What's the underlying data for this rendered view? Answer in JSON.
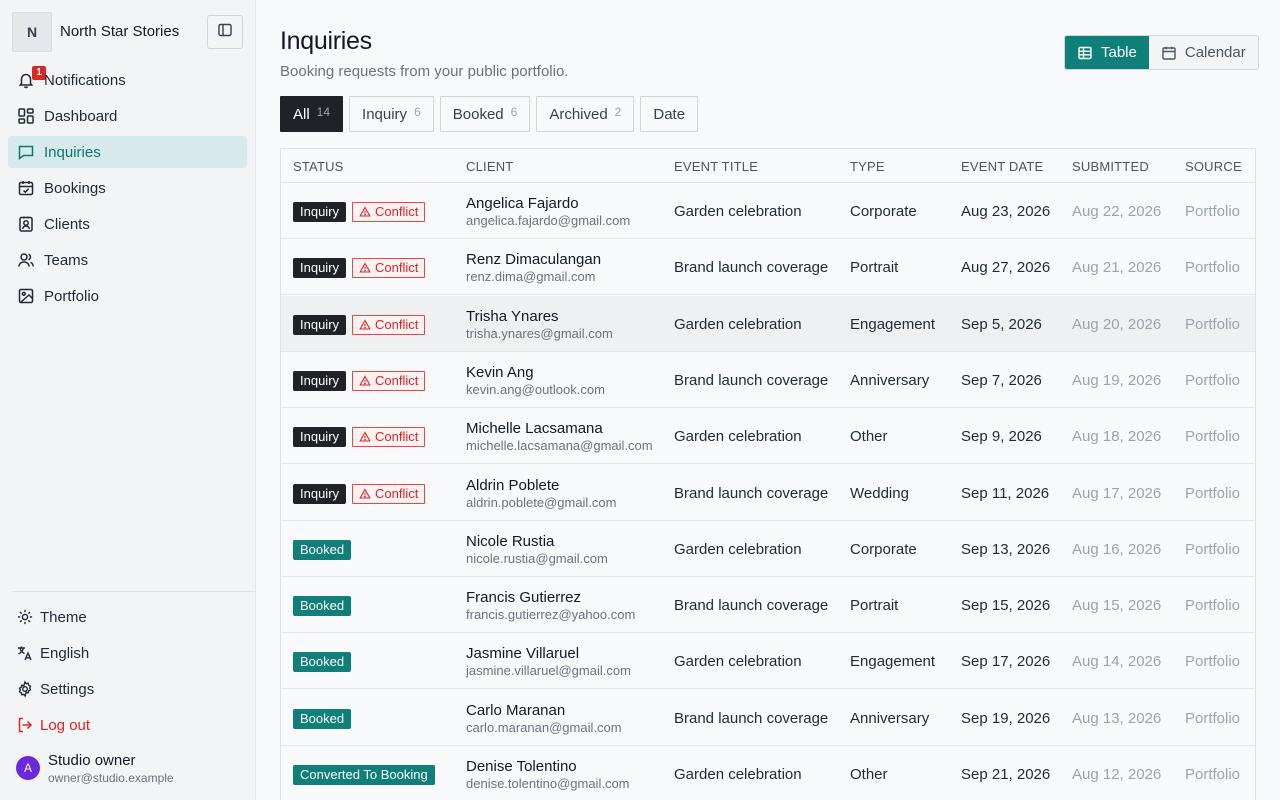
{
  "workspace": {
    "initial": "N",
    "name": "North Star Stories"
  },
  "nav": {
    "notifications": {
      "label": "Notifications",
      "badge": "1"
    },
    "dashboard": "Dashboard",
    "inquiries": "Inquiries",
    "bookings": "Bookings",
    "clients": "Clients",
    "teams": "Teams",
    "portfolio": "Portfolio"
  },
  "bottom_nav": {
    "theme": "Theme",
    "language": "English",
    "settings": "Settings",
    "logout": "Log out"
  },
  "user": {
    "initial": "A",
    "name": "Studio owner",
    "email": "owner@studio.example"
  },
  "page": {
    "title": "Inquiries",
    "subtitle": "Booking requests from your public portfolio."
  },
  "view_toggle": {
    "table": "Table",
    "calendar": "Calendar"
  },
  "filters": [
    {
      "label": "All",
      "count": "14"
    },
    {
      "label": "Inquiry",
      "count": "6"
    },
    {
      "label": "Booked",
      "count": "6"
    },
    {
      "label": "Archived",
      "count": "2"
    },
    {
      "label": "Date",
      "count": ""
    }
  ],
  "table": {
    "columns": [
      "STATUS",
      "CLIENT",
      "EVENT TITLE",
      "TYPE",
      "EVENT DATE",
      "SUBMITTED",
      "SOURCE"
    ],
    "conflict_label": "Conflict",
    "rows": [
      {
        "status": "Inquiry",
        "conflict": true,
        "name": "Angelica Fajardo",
        "email": "angelica.fajardo@gmail.com",
        "title": "Garden celebration",
        "type": "Corporate",
        "date": "Aug 23, 2026",
        "submitted": "Aug 22, 2026",
        "source": "Portfolio"
      },
      {
        "status": "Inquiry",
        "conflict": true,
        "name": "Renz Dimaculangan",
        "email": "renz.dima@gmail.com",
        "title": "Brand launch coverage",
        "type": "Portrait",
        "date": "Aug 27, 2026",
        "submitted": "Aug 21, 2026",
        "source": "Portfolio"
      },
      {
        "status": "Inquiry",
        "conflict": true,
        "name": "Trisha Ynares",
        "email": "trisha.ynares@gmail.com",
        "title": "Garden celebration",
        "type": "Engagement",
        "date": "Sep 5, 2026",
        "submitted": "Aug 20, 2026",
        "source": "Portfolio"
      },
      {
        "status": "Inquiry",
        "conflict": true,
        "name": "Kevin Ang",
        "email": "kevin.ang@outlook.com",
        "title": "Brand launch coverage",
        "type": "Anniversary",
        "date": "Sep 7, 2026",
        "submitted": "Aug 19, 2026",
        "source": "Portfolio"
      },
      {
        "status": "Inquiry",
        "conflict": true,
        "name": "Michelle Lacsamana",
        "email": "michelle.lacsamana@gmail.com",
        "title": "Garden celebration",
        "type": "Other",
        "date": "Sep 9, 2026",
        "submitted": "Aug 18, 2026",
        "source": "Portfolio"
      },
      {
        "status": "Inquiry",
        "conflict": true,
        "name": "Aldrin Poblete",
        "email": "aldrin.poblete@gmail.com",
        "title": "Brand launch coverage",
        "type": "Wedding",
        "date": "Sep 11, 2026",
        "submitted": "Aug 17, 2026",
        "source": "Portfolio"
      },
      {
        "status": "Booked",
        "conflict": false,
        "name": "Nicole Rustia",
        "email": "nicole.rustia@gmail.com",
        "title": "Garden celebration",
        "type": "Corporate",
        "date": "Sep 13, 2026",
        "submitted": "Aug 16, 2026",
        "source": "Portfolio"
      },
      {
        "status": "Booked",
        "conflict": false,
        "name": "Francis Gutierrez",
        "email": "francis.gutierrez@yahoo.com",
        "title": "Brand launch coverage",
        "type": "Portrait",
        "date": "Sep 15, 2026",
        "submitted": "Aug 15, 2026",
        "source": "Portfolio"
      },
      {
        "status": "Booked",
        "conflict": false,
        "name": "Jasmine Villaruel",
        "email": "jasmine.villaruel@gmail.com",
        "title": "Garden celebration",
        "type": "Engagement",
        "date": "Sep 17, 2026",
        "submitted": "Aug 14, 2026",
        "source": "Portfolio"
      },
      {
        "status": "Booked",
        "conflict": false,
        "name": "Carlo Maranan",
        "email": "carlo.maranan@gmail.com",
        "title": "Brand launch coverage",
        "type": "Anniversary",
        "date": "Sep 19, 2026",
        "submitted": "Aug 13, 2026",
        "source": "Portfolio"
      },
      {
        "status": "Converted To Booking",
        "conflict": false,
        "name": "Denise Tolentino",
        "email": "denise.tolentino@gmail.com",
        "title": "Garden celebration",
        "type": "Other",
        "date": "Sep 21, 2026",
        "submitted": "Aug 12, 2026",
        "source": "Portfolio"
      }
    ]
  },
  "colors": {
    "accent": "#0f7f7a",
    "active_nav_bg": "#d6e9eb",
    "danger": "#dc2626",
    "dark": "#1f2328"
  }
}
